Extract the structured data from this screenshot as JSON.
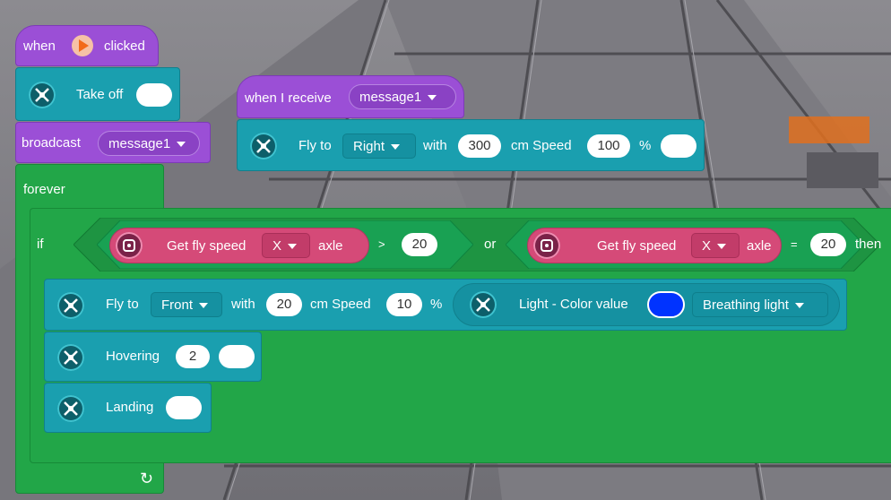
{
  "when_clicked": {
    "when": "when",
    "clicked": "clicked",
    "icon": "green-flag-play-icon",
    "color": "#9b4fd6"
  },
  "take_off": {
    "label": "Take off",
    "icon": "drone-icon"
  },
  "broadcast": {
    "label": "broadcast",
    "message": "message1"
  },
  "forever": {
    "label": "forever",
    "color": "#22a648"
  },
  "if_block": {
    "if_label": "if",
    "left": {
      "label": "Get fly speed",
      "axis": "X",
      "suffix": "axle",
      "operator": ">",
      "value": "20"
    },
    "or_label": "or",
    "right": {
      "label": "Get fly speed",
      "axis": "X",
      "suffix": "axle",
      "operator": "=",
      "value": "20"
    },
    "then_label": "then"
  },
  "fly_front": {
    "label": "Fly to",
    "direction": "Front",
    "with": "with",
    "distance": "20",
    "unit": "cm Speed",
    "speed": "10",
    "percent": "%"
  },
  "light": {
    "label": "Light - Color value",
    "color": "#0033ff",
    "mode": "Breathing light"
  },
  "hovering": {
    "label": "Hovering",
    "value": "2"
  },
  "landing": {
    "label": "Landing"
  },
  "when_receive": {
    "label": "when I receive",
    "message": "message1"
  },
  "fly_right": {
    "label": "Fly to",
    "direction": "Right",
    "with": "with",
    "distance": "300",
    "unit": "cm Speed",
    "speed": "100",
    "percent": "%"
  },
  "loop_arrow": "↻"
}
